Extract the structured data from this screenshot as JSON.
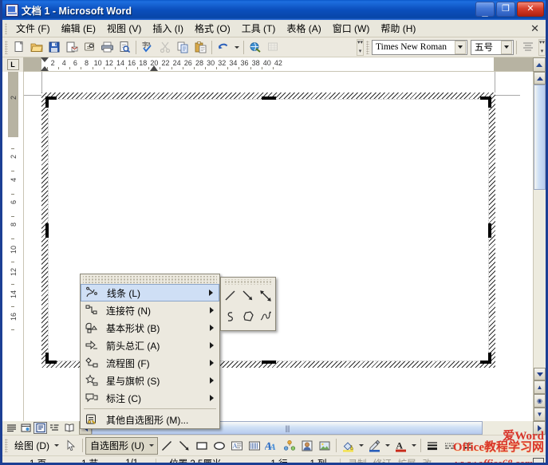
{
  "window": {
    "title": "文档 1 - Microsoft Word",
    "icon": "word-document-icon",
    "buttons": {
      "minimize": "_",
      "maximize": "□",
      "close": "✕"
    }
  },
  "menubar": {
    "items": [
      {
        "label": "文件 (F)",
        "name": "menu-file"
      },
      {
        "label": "编辑 (E)",
        "name": "menu-edit"
      },
      {
        "label": "视图 (V)",
        "name": "menu-view"
      },
      {
        "label": "插入 (I)",
        "name": "menu-insert"
      },
      {
        "label": "格式 (O)",
        "name": "menu-format"
      },
      {
        "label": "工具 (T)",
        "name": "menu-tools"
      },
      {
        "label": "表格 (A)",
        "name": "menu-table"
      },
      {
        "label": "窗口 (W)",
        "name": "menu-window"
      },
      {
        "label": "帮助 (H)",
        "name": "menu-help"
      }
    ],
    "close_document_label": "✕"
  },
  "toolbar": {
    "buttons": [
      "new-document-icon",
      "open-folder-icon",
      "save-icon",
      "email-icon",
      "permission-icon",
      "print-icon",
      "print-preview-icon",
      "spell-check-icon",
      "cut-scissors-icon",
      "copy-icon",
      "paste-icon",
      "undo-icon",
      "insert-hyperlink-icon",
      "insert-table-icon"
    ],
    "font_name": "Times New Roman",
    "font_size": "五号",
    "align_icon": "align-center-icon"
  },
  "ruler": {
    "horizontal": {
      "unit_labels": [
        "2",
        "4",
        "6",
        "8",
        "10",
        "12",
        "14",
        "16",
        "18",
        "20",
        "22",
        "24",
        "26",
        "28",
        "30",
        "32",
        "34",
        "36",
        "38",
        "40",
        "42"
      ],
      "corner_label": "L"
    },
    "vertical": {
      "unit_labels": [
        "2",
        "2",
        "4",
        "6",
        "8",
        "10",
        "12",
        "14",
        "16"
      ]
    }
  },
  "document": {
    "object_name": "drawing-canvas",
    "selected": true
  },
  "context_menu": {
    "name": "autoshapes-menu",
    "items": [
      {
        "label": "线条 (L)",
        "icon": "lines-icon",
        "submenu": true,
        "selected": true
      },
      {
        "label": "连接符 (N)",
        "icon": "connectors-icon",
        "submenu": true,
        "selected": false
      },
      {
        "label": "基本形状 (B)",
        "icon": "basic-shapes-icon",
        "submenu": true,
        "selected": false
      },
      {
        "label": "箭头总汇 (A)",
        "icon": "block-arrows-icon",
        "submenu": true,
        "selected": false
      },
      {
        "label": "流程图 (F)",
        "icon": "flowchart-icon",
        "submenu": true,
        "selected": false
      },
      {
        "label": "星与旗帜 (S)",
        "icon": "stars-banners-icon",
        "submenu": true,
        "selected": false
      },
      {
        "label": "标注 (C)",
        "icon": "callouts-icon",
        "submenu": true,
        "selected": false
      },
      {
        "label": "其他自选图形 (M)...",
        "icon": "more-autoshapes-icon",
        "submenu": false,
        "selected": false
      }
    ]
  },
  "submenu": {
    "name": "lines-submenu",
    "items": [
      "line-icon",
      "arrow-icon",
      "double-arrow-icon",
      "curve-icon",
      "freeform-icon",
      "scribble-icon"
    ]
  },
  "view_modes": [
    {
      "name": "normal-view-button",
      "icon": "normal-view-icon",
      "active": false
    },
    {
      "name": "web-layout-view-button",
      "icon": "web-layout-icon",
      "active": false
    },
    {
      "name": "print-layout-view-button",
      "icon": "print-layout-icon",
      "active": true
    },
    {
      "name": "outline-view-button",
      "icon": "outline-view-icon",
      "active": false
    },
    {
      "name": "reading-view-button",
      "icon": "reading-view-icon",
      "active": false
    }
  ],
  "drawing_toolbar": {
    "draw_label": "绘图 (D)",
    "select_icon": "select-objects-icon",
    "autoshapes_label": "自选图形 (U)",
    "autoshapes_pressed": true,
    "tools": [
      "line-icon",
      "arrow-icon",
      "rectangle-icon",
      "oval-icon",
      "text-box-icon",
      "vertical-text-box-icon",
      "wordart-icon",
      "diagram-icon",
      "clip-art-icon",
      "picture-icon"
    ],
    "color_tools": [
      "fill-color-icon",
      "line-color-icon",
      "font-color-icon"
    ],
    "style_tools": [
      "line-style-icon",
      "dash-style-icon",
      "arrow-style-icon"
    ]
  },
  "watermark": {
    "line1_prefix": "爱",
    "line1_word": "Word",
    "line2": "Office教程学习网",
    "line3": "www.office68.com"
  },
  "statusbar": {
    "page": "1 页",
    "section": "1 节",
    "page_of": "1/1",
    "position": "位置 2.5厘米",
    "line": "1 行",
    "column": "1 列",
    "rec": "录制",
    "trk": "修订",
    "ext": "扩展",
    "ovr": "改"
  },
  "colors": {
    "titlebar": "#0b4fbd",
    "frame": "#1c3f94",
    "toolbar_bg": "#ece9df",
    "menu_bg": "#e9e7dc",
    "selection": "#cfdff5",
    "watermark_red": "#d8342a"
  }
}
